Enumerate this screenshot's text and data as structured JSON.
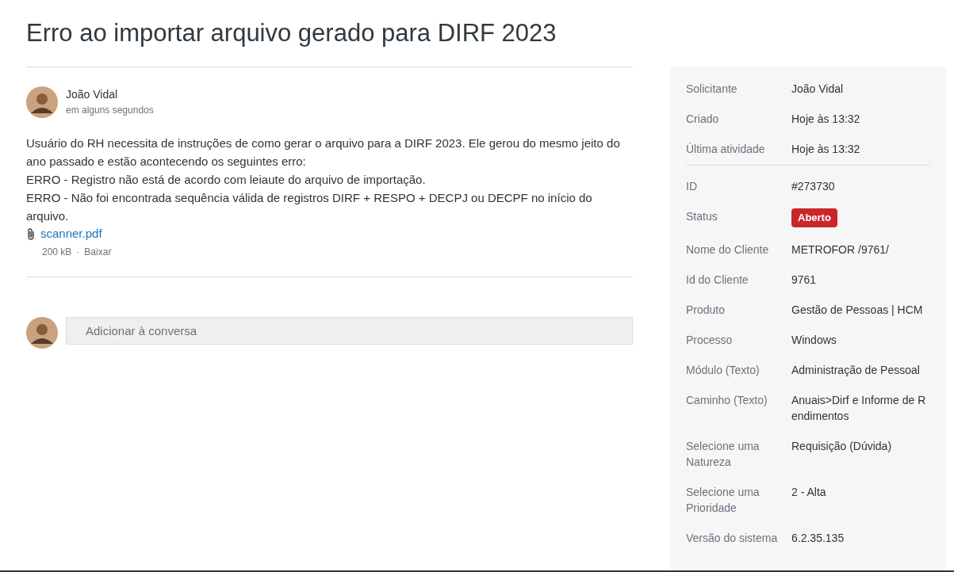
{
  "title": "Erro ao importar arquivo gerado para DIRF 2023",
  "post": {
    "author": "João Vidal",
    "time": "em alguns segundos",
    "lines": [
      "Usuário do RH necessita de instruções de como gerar o arquivo para a DIRF 2023. Ele gerou do mesmo jeito do ano passado e estão acontecendo os seguintes erro:",
      "ERRO - Registro não está de acordo com leiaute do arquivo de importação.",
      "ERRO - Não foi encontrada sequência válida de registros DIRF + RESPO + DECPJ ou DECPF no início do arquivo."
    ],
    "attachment": {
      "name": "scanner.pdf",
      "size": "200 kB",
      "separator": "·",
      "action": "Baixar"
    }
  },
  "reply": {
    "placeholder": "Adicionar à conversa"
  },
  "details": [
    [
      {
        "label": "Solicitante",
        "value": "João Vidal",
        "kind": "text"
      },
      {
        "label": "Criado",
        "value": "Hoje às 13:32",
        "kind": "text"
      },
      {
        "label": "Última atividade",
        "value": "Hoje às 13:32",
        "kind": "text"
      }
    ],
    [
      {
        "label": "ID",
        "value": "#273730",
        "kind": "text"
      },
      {
        "label": "Status",
        "value": "Aberto",
        "kind": "badge",
        "color": "#c9262c"
      },
      {
        "label": "Nome do Cliente",
        "value": "METROFOR /9761/",
        "kind": "text"
      },
      {
        "label": "Id do Cliente",
        "value": "9761",
        "kind": "text"
      },
      {
        "label": "Produto",
        "value": "Gestão de Pessoas | HCM",
        "kind": "text"
      },
      {
        "label": "Processo",
        "value": "Windows",
        "kind": "text"
      },
      {
        "label": "Módulo (Texto)",
        "value": "Administração de Pessoal",
        "kind": "text"
      },
      {
        "label": "Caminho (Texto)",
        "value": "Anuais>Dirf e Informe de Rendimentos",
        "kind": "text"
      },
      {
        "label": "Selecione uma Natureza",
        "value": "Requisição (Dúvida)",
        "kind": "text"
      },
      {
        "label": "Selecione uma Prioridade",
        "value": "2 - Alta",
        "kind": "text"
      },
      {
        "label": "Versão do sistema",
        "value": "6.2.35.135",
        "kind": "text"
      }
    ]
  ]
}
